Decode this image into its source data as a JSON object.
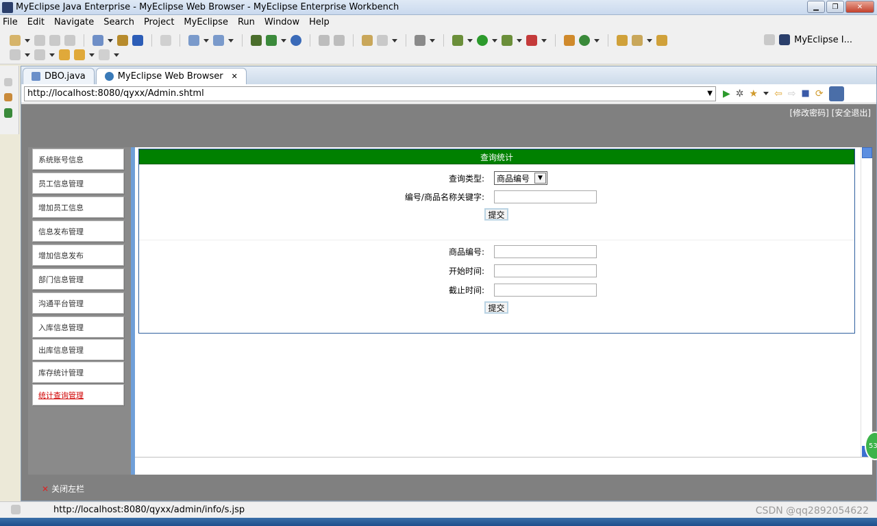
{
  "window": {
    "title": "MyEclipse Java Enterprise - MyEclipse Web Browser - MyEclipse Enterprise Workbench"
  },
  "menu": [
    "File",
    "Edit",
    "Navigate",
    "Search",
    "Project",
    "MyEclipse",
    "Run",
    "Window",
    "Help"
  ],
  "perspective": {
    "label": "MyEclipse I..."
  },
  "tabs": [
    {
      "label": "DBO.java",
      "icon": "java-file-icon"
    },
    {
      "label": "MyEclipse Web Browser",
      "icon": "globe-icon"
    }
  ],
  "url": "http://localhost:8080/qyxx/Admin.shtml",
  "header": {
    "links": "[修改密码] [安全退出]"
  },
  "sidebar": {
    "items": [
      {
        "label": "系统账号信息"
      },
      {
        "label": "员工信息管理"
      },
      {
        "label": "增加员工信息"
      },
      {
        "label": "信息发布管理"
      },
      {
        "label": "增加信息发布"
      },
      {
        "label": "部门信息管理"
      },
      {
        "label": "沟通平台管理"
      },
      {
        "label": "入库信息管理"
      },
      {
        "label": "出库信息管理"
      },
      {
        "label": "库存统计管理"
      },
      {
        "label": "统计查询管理"
      }
    ],
    "active_index": 10
  },
  "panel": {
    "title": "查询统计",
    "form1": {
      "type_label": "查询类型:",
      "type_value": "商品编号",
      "keyword_label": "编号/商品名称关键字:",
      "keyword_value": "",
      "submit": "提交"
    },
    "form2": {
      "code_label": "商品编号:",
      "code_value": "",
      "start_label": "开始时间:",
      "start_value": "",
      "end_label": "截止时间:",
      "end_value": "",
      "submit": "提交"
    }
  },
  "footer": {
    "close_left": "关闭左栏"
  },
  "status": {
    "url": "http://localhost:8080/qyxx/admin/info/s.jsp",
    "watermark": "CSDN @qq2892054622"
  },
  "badge": "53"
}
